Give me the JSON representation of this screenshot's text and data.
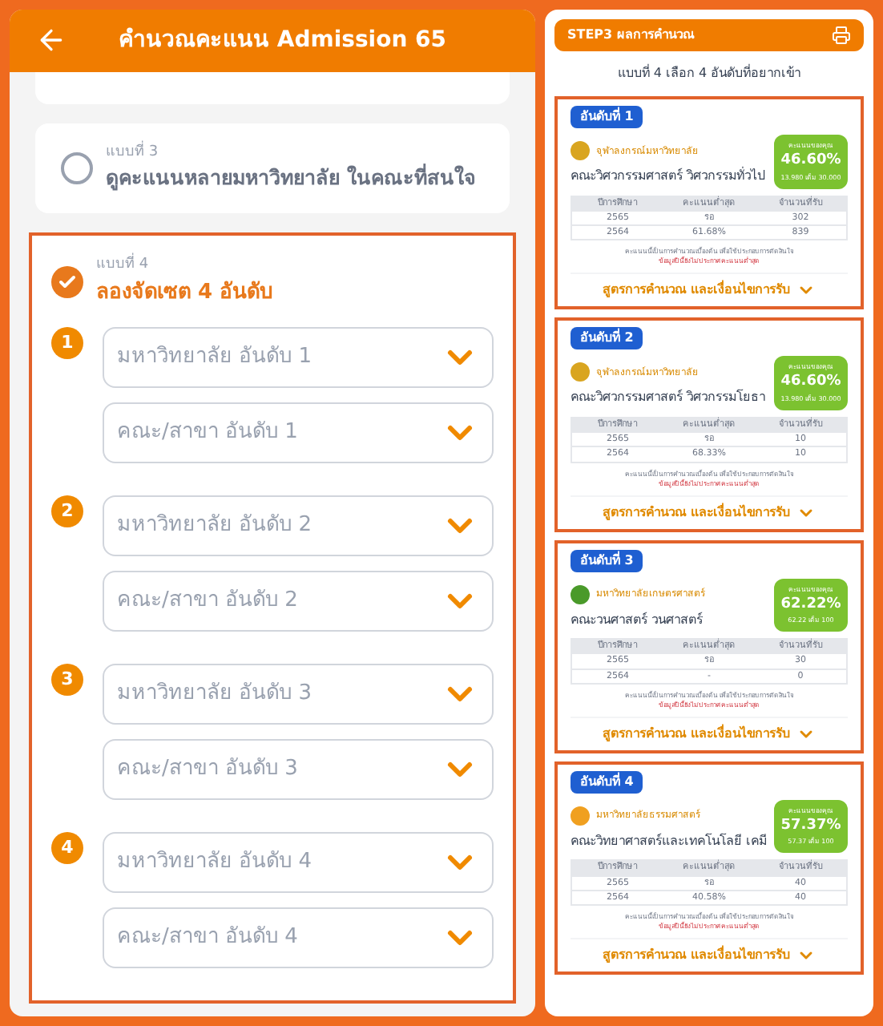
{
  "header": {
    "title": "คำนวณคะแนน Admission 65"
  },
  "options": [
    {
      "label": "แบบที่ 3",
      "title": "ดูคะแนนหลายมหาวิทยาลัย ในคณะที่สนใจ",
      "selected": false
    },
    {
      "label": "แบบที่ 4",
      "title": "ลองจัดเซต 4 อันดับ",
      "selected": true,
      "ranks": [
        {
          "number": "1",
          "university_placeholder": "มหาวิทยาลัย อันดับ 1",
          "faculty_placeholder": "คณะ/สาขา อันดับ 1"
        },
        {
          "number": "2",
          "university_placeholder": "มหาวิทยาลัย อันดับ 2",
          "faculty_placeholder": "คณะ/สาขา อันดับ 2"
        },
        {
          "number": "3",
          "university_placeholder": "มหาวิทยาลัย อันดับ 3",
          "faculty_placeholder": "คณะ/สาขา อันดับ 3"
        },
        {
          "number": "4",
          "university_placeholder": "มหาวิทยาลัย อันดับ 4",
          "faculty_placeholder": "คณะ/สาขา อันดับ 4"
        }
      ]
    }
  ],
  "results": {
    "title": "STEP3 ผลการคำนวณ",
    "subtitle": "แบบที่ 4 เลือก 4 อันดับที่อยากเข้า",
    "cards": [
      {
        "badge": "อันดับที่ 1",
        "university": "จุฬาลงกรณ์มหาวิทยาลัย",
        "color": "#d9a520",
        "faculty": "คณะวิศวกรรมศาสตร์ วิศวกรรมทั่วไป",
        "score_label": "คะแนนของคุณ",
        "score": "46.60%",
        "score_note": "13.980 เต็ม 30.000",
        "columns": [
          "ปีการศึกษา",
          "คะแนนต่ำสุด",
          "จำนวนที่รับ"
        ],
        "rows": [
          [
            "2565",
            "รอ",
            "302"
          ],
          [
            "2564",
            "61.68%",
            "839"
          ]
        ],
        "notes": [
          "คะแนนนี้เป็นการคำนวณเบื้องต้น เพื่อใช้ประกอบการตัดสินใจ",
          "ข้อมูลปีนี้ยังไม่ประกาศคะแนนต่ำสุด"
        ],
        "link": "สูตรการคำนวณ และเงื่อนไขการรับ"
      },
      {
        "badge": "อันดับที่ 2",
        "university": "จุฬาลงกรณ์มหาวิทยาลัย",
        "color": "#d9a520",
        "faculty": "คณะวิศวกรรมศาสตร์ วิศวกรรมโยธา",
        "score_label": "คะแนนของคุณ",
        "score": "46.60%",
        "score_note": "13.980 เต็ม 30.000",
        "columns": [
          "ปีการศึกษา",
          "คะแนนต่ำสุด",
          "จำนวนที่รับ"
        ],
        "rows": [
          [
            "2565",
            "รอ",
            "10"
          ],
          [
            "2564",
            "68.33%",
            "10"
          ]
        ],
        "notes": [
          "คะแนนนี้เป็นการคำนวณเบื้องต้น เพื่อใช้ประกอบการตัดสินใจ",
          "ข้อมูลปีนี้ยังไม่ประกาศคะแนนต่ำสุด"
        ],
        "link": "สูตรการคำนวณ และเงื่อนไขการรับ"
      },
      {
        "badge": "อันดับที่ 3",
        "university": "มหาวิทยาลัยเกษตรศาสตร์",
        "color": "#4a9a2a",
        "faculty": "คณะวนศาสตร์ วนศาสตร์",
        "score_label": "คะแนนของคุณ",
        "score": "62.22%",
        "score_note": "62.22 เต็ม 100",
        "columns": [
          "ปีการศึกษา",
          "คะแนนต่ำสุด",
          "จำนวนที่รับ"
        ],
        "rows": [
          [
            "2565",
            "รอ",
            "30"
          ],
          [
            "2564",
            "-",
            "0"
          ]
        ],
        "notes": [
          "คะแนนนี้เป็นการคำนวณเบื้องต้น เพื่อใช้ประกอบการตัดสินใจ",
          "ข้อมูลปีนี้ยังไม่ประกาศคะแนนต่ำสุด"
        ],
        "link": "สูตรการคำนวณ และเงื่อนไขการรับ"
      },
      {
        "badge": "อันดับที่ 4",
        "university": "มหาวิทยาลัยธรรมศาสตร์",
        "color": "#f0a020",
        "faculty": "คณะวิทยาศาสตร์และเทคโนโลยี เคมี",
        "score_label": "คะแนนของคุณ",
        "score": "57.37%",
        "score_note": "57.37 เต็ม 100",
        "columns": [
          "ปีการศึกษา",
          "คะแนนต่ำสุด",
          "จำนวนที่รับ"
        ],
        "rows": [
          [
            "2565",
            "รอ",
            "40"
          ],
          [
            "2564",
            "40.58%",
            "40"
          ]
        ],
        "notes": [
          "คะแนนนี้เป็นการคำนวณเบื้องต้น เพื่อใช้ประกอบการตัดสินใจ",
          "ข้อมูลปีนี้ยังไม่ประกาศคะแนนต่ำสุด"
        ],
        "link": "สูตรการคำนวณ และเงื่อนไขการรับ"
      }
    ]
  }
}
